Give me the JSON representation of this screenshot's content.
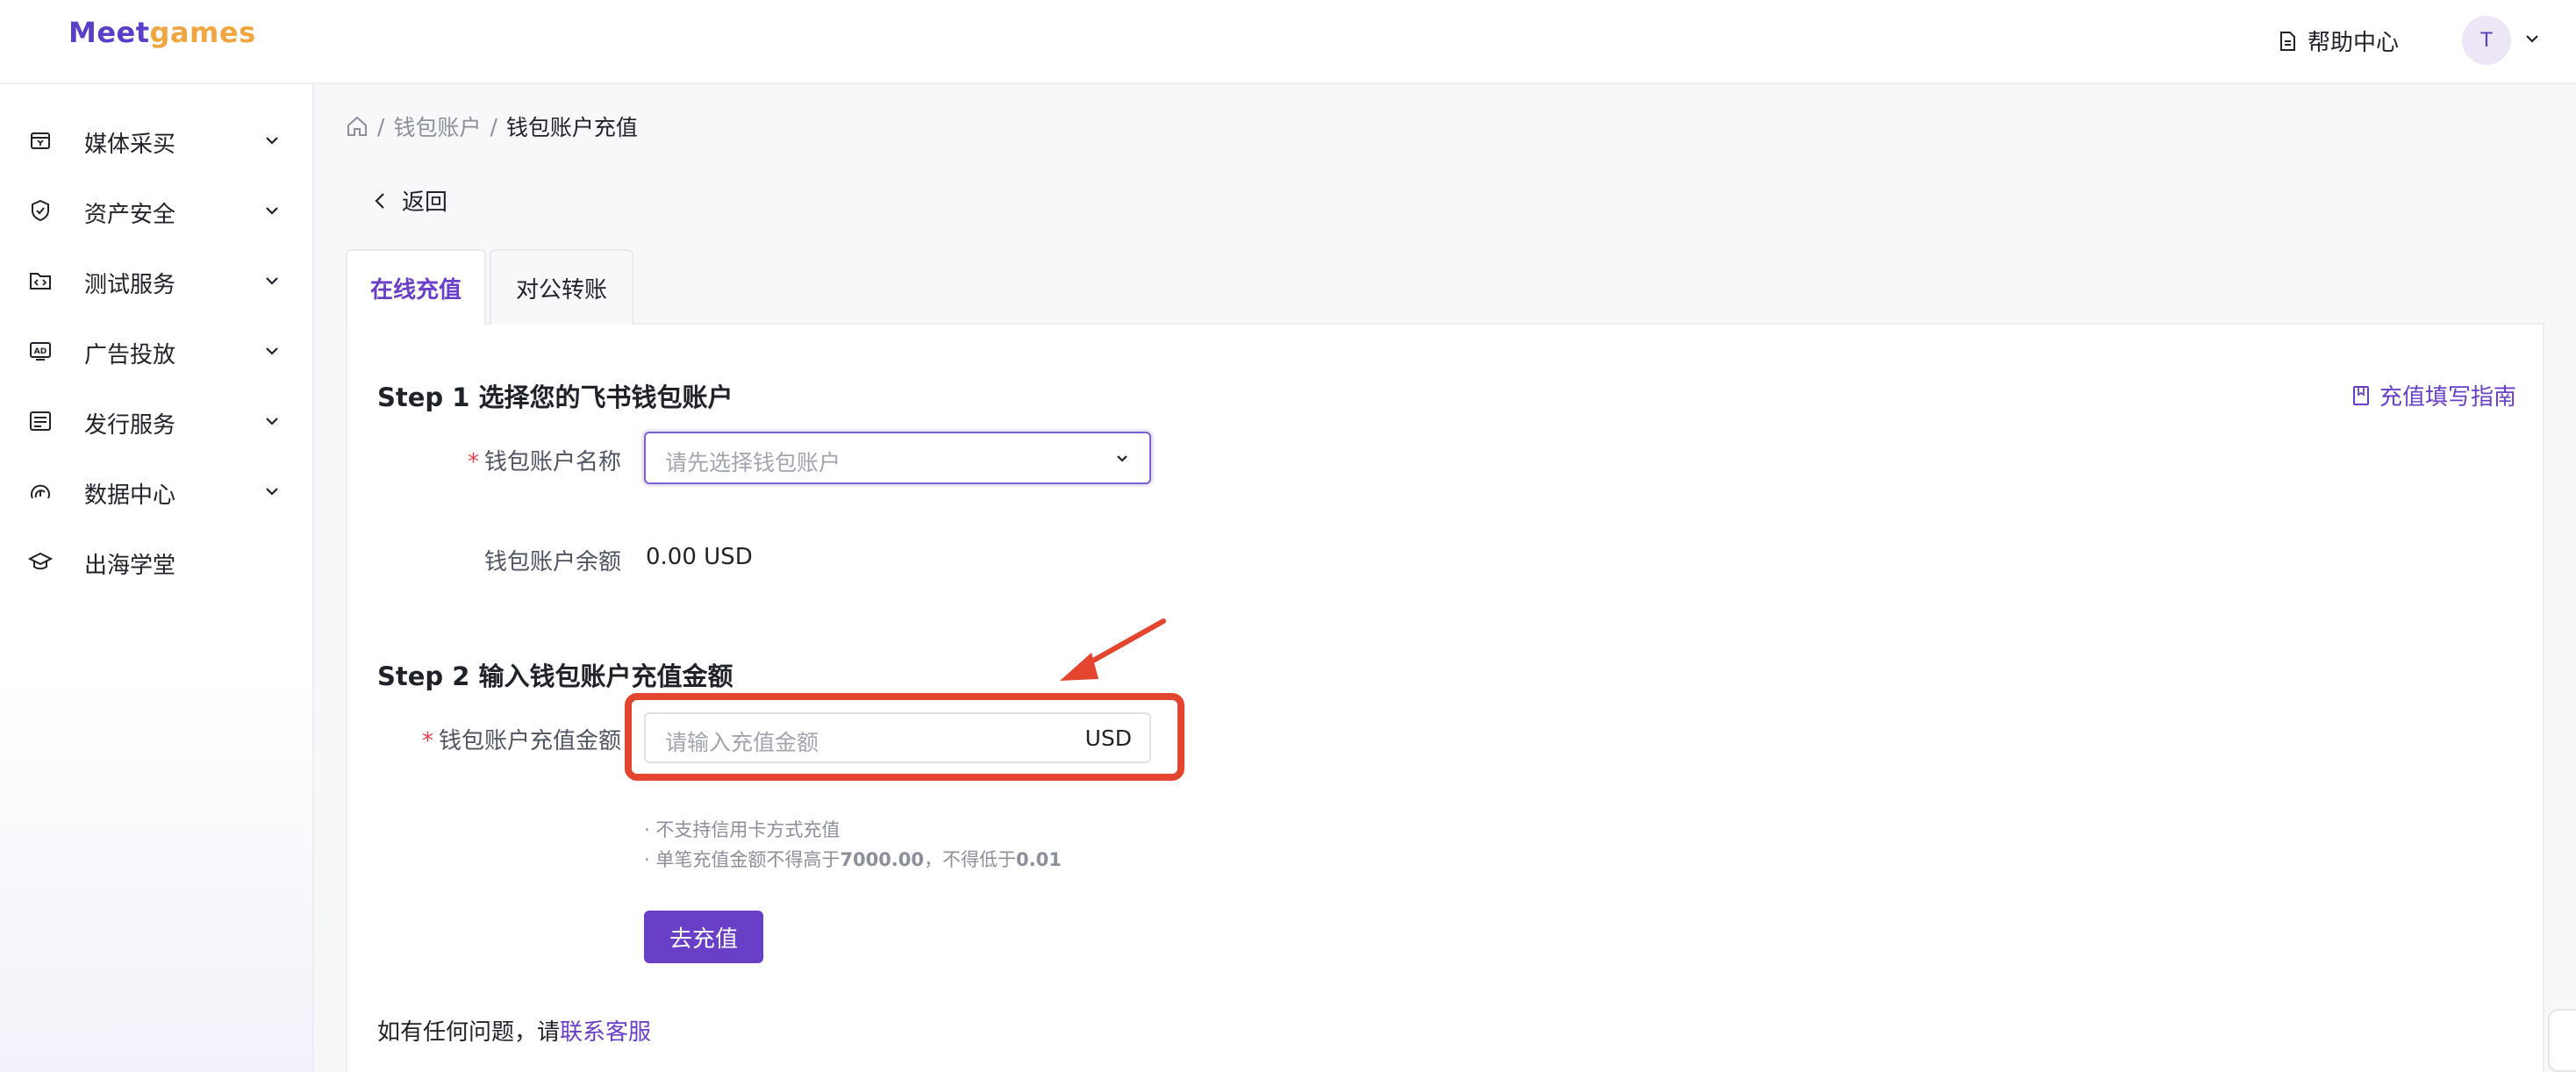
{
  "header": {
    "logo_meet": "Meet",
    "logo_games": "games",
    "help_label": "帮助中心",
    "avatar_text": "T"
  },
  "sidebar": {
    "items": [
      {
        "label": "媒体采买",
        "icon": "shopping-bag-icon",
        "has_caret": true
      },
      {
        "label": "资产安全",
        "icon": "shield-icon",
        "has_caret": true
      },
      {
        "label": "测试服务",
        "icon": "code-folder-icon",
        "has_caret": true
      },
      {
        "label": "广告投放",
        "icon": "ad-icon",
        "has_caret": true
      },
      {
        "label": "发行服务",
        "icon": "publish-icon",
        "has_caret": true
      },
      {
        "label": "数据中心",
        "icon": "gauge-icon",
        "has_caret": true
      },
      {
        "label": "出海学堂",
        "icon": "graduation-cap-icon",
        "has_caret": false
      }
    ]
  },
  "breadcrumb": {
    "sep": "/",
    "level1": "钱包账户",
    "current": "钱包账户充值"
  },
  "back_label": "返回",
  "tabs": [
    {
      "label": "在线充值",
      "active": true
    },
    {
      "label": "对公转账",
      "active": false
    }
  ],
  "step1": {
    "title": "Step 1 选择您的飞书钱包账户",
    "guide_label": "充值填写指南",
    "account_label": "钱包账户名称",
    "account_placeholder": "请先选择钱包账户",
    "balance_label": "钱包账户余额",
    "balance_value": "0.00 USD"
  },
  "step2": {
    "title": "Step 2 输入钱包账户充值金额",
    "amount_label": "钱包账户充值金额",
    "amount_placeholder": "请输入充值金额",
    "currency": "USD",
    "note1": "· 不支持信用卡方式充值",
    "note2_prefix": "· 单笔充值金额不得高于",
    "note2_max": "7000.00",
    "note2_mid": "，不得低于",
    "note2_min": "0.01",
    "submit_label": "去充值"
  },
  "footer": {
    "contact_prefix": "如有任何问题，请",
    "contact_link": "联系客服"
  },
  "colors": {
    "accent": "#6a3fc8",
    "annotation": "#e4452e",
    "required": "#e5404a"
  }
}
